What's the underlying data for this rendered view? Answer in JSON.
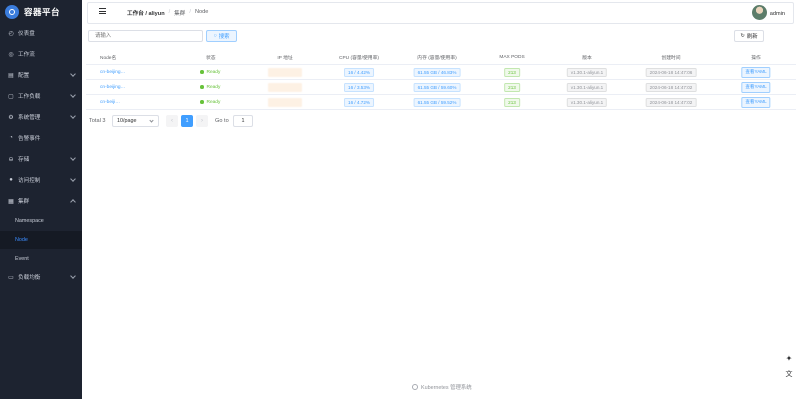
{
  "app": {
    "title": "容器平台"
  },
  "sidebar": {
    "items": [
      {
        "label": "仪表盘",
        "icon": "dashboard-icon",
        "chev": false
      },
      {
        "label": "工作流",
        "icon": "workflow-icon",
        "chev": false
      },
      {
        "label": "配置",
        "icon": "config-icon",
        "chev": true
      },
      {
        "label": "工作负载",
        "icon": "workload-icon",
        "chev": true
      },
      {
        "label": "系统管理",
        "icon": "gear-icon",
        "chev": true
      },
      {
        "label": "告警事件",
        "icon": "bell-icon",
        "chev": false
      },
      {
        "label": "存储",
        "icon": "storage-icon",
        "chev": true
      },
      {
        "label": "访问控制",
        "icon": "user-icon",
        "chev": true
      },
      {
        "label": "集群",
        "icon": "grid-icon",
        "chev": true,
        "expanded": true
      },
      {
        "label": "负载均衡",
        "icon": "loadbalance-icon",
        "chev": true
      }
    ],
    "cluster_children": [
      {
        "label": "Namespace",
        "active": false
      },
      {
        "label": "Node",
        "active": true
      },
      {
        "label": "Event",
        "active": false
      }
    ]
  },
  "header": {
    "breadcrumbs": [
      "工作台 / aliyun",
      "集群",
      "Node"
    ],
    "username": "admin"
  },
  "toolbar": {
    "search_placeholder": "请输入",
    "search_label": "搜索",
    "refresh_label": "刷新"
  },
  "table": {
    "columns": [
      "Node名",
      "状态",
      "IP 地址",
      "CPU (容量/使用率)",
      "内存 (容量/使用率)",
      "MAX PODS",
      "版本",
      "创建时间",
      "操作"
    ],
    "rows": [
      {
        "name": "cn-beijing…",
        "status": "Ready",
        "cpu": "16 / 4.42%",
        "memory": "61.55 GB / 46.83%",
        "max_pods": "213",
        "version": "v1.30.1-aliyun.1",
        "created": "2024-06-18 14:47:06",
        "action": "查看YAML"
      },
      {
        "name": "cn-beijing…",
        "status": "Ready",
        "cpu": "16 / 3.53%",
        "memory": "61.55 GB / 59.60%",
        "max_pods": "213",
        "version": "v1.30.1-aliyun.1",
        "created": "2024-06-18 14:47:02",
        "action": "查看YAML"
      },
      {
        "name": "cn-beiji…",
        "status": "Ready",
        "cpu": "16 / 4.72%",
        "memory": "61.55 GB / 59.52%",
        "max_pods": "213",
        "version": "v1.30.1-aliyun.1",
        "created": "2024-06-18 14:47:02",
        "action": "查看YAML"
      }
    ]
  },
  "pagination": {
    "total": "Total 3",
    "page_size": "10/page",
    "current_page": "1",
    "goto_label": "Go to",
    "goto_value": "1"
  },
  "footer": {
    "text": "Kubernetes 管理系统"
  },
  "colors": {
    "sidebar_bg": "#1d2330",
    "accent": "#409eff",
    "success": "#67c23a"
  }
}
